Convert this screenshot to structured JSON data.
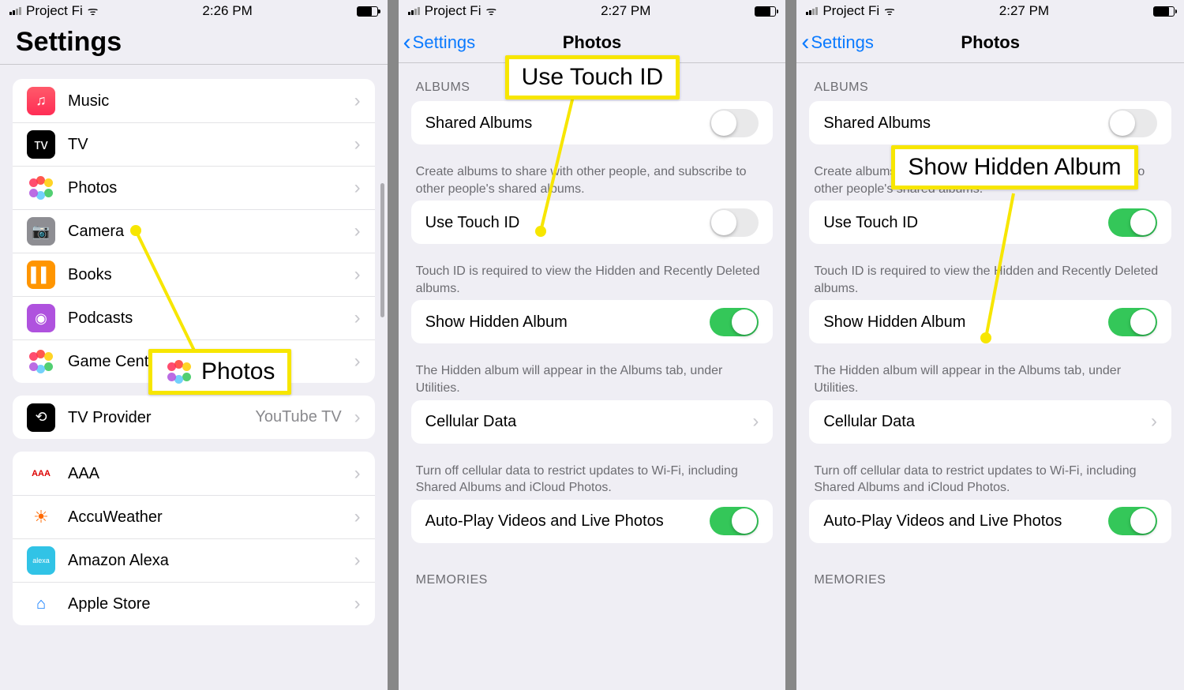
{
  "status": {
    "carrier": "Project Fi"
  },
  "screen1": {
    "time": "2:26 PM",
    "title": "Settings",
    "items_media": [
      {
        "label": "Music",
        "icon": "ic-music",
        "glyph": "♫"
      },
      {
        "label": "TV",
        "icon": "ic-tv",
        "glyph": "ᴛᴠ"
      },
      {
        "label": "Photos",
        "icon": "ic-photos",
        "glyph": ""
      },
      {
        "label": "Camera",
        "icon": "ic-camera",
        "glyph": "📷"
      },
      {
        "label": "Books",
        "icon": "ic-books",
        "glyph": "▌▌"
      },
      {
        "label": "Podcasts",
        "icon": "ic-podcasts",
        "glyph": "◉"
      },
      {
        "label": "Game Center",
        "icon": "ic-gamecenter",
        "glyph": "●●"
      }
    ],
    "items_tvprov": [
      {
        "label": "TV Provider",
        "icon": "ic-tvprov",
        "glyph": "⟲",
        "value": "YouTube TV"
      }
    ],
    "items_apps": [
      {
        "label": "AAA",
        "icon": "ic-aaa",
        "glyph": "AAA"
      },
      {
        "label": "AccuWeather",
        "icon": "ic-accu",
        "glyph": "☀"
      },
      {
        "label": "Amazon Alexa",
        "icon": "ic-alexa",
        "glyph": "alexa"
      },
      {
        "label": "Apple Store",
        "icon": "ic-appstore",
        "glyph": ""
      }
    ],
    "callout": {
      "text": "Photos"
    }
  },
  "photos_screen": {
    "time": "2:27 PM",
    "back": "Settings",
    "title": "Photos",
    "section_albums": "ALBUMS",
    "shared_albums": "Shared Albums",
    "shared_footer": "Create albums to share with other people, and subscribe to other people's shared albums.",
    "use_touch_id": "Use Touch ID",
    "touch_footer": "Touch ID is required to view the Hidden and Recently Deleted albums.",
    "show_hidden": "Show Hidden Album",
    "hidden_footer": "The Hidden album will appear in the Albums tab, under Utilities.",
    "cellular": "Cellular Data",
    "cellular_footer": "Turn off cellular data to restrict updates to Wi-Fi, including Shared Albums and iCloud Photos.",
    "autoplay": "Auto-Play Videos and Live Photos",
    "section_memories": "MEMORIES"
  },
  "screen2": {
    "touch_on": false,
    "hidden_on": true,
    "autoplay_on": true,
    "callout": {
      "text": "Use Touch ID"
    }
  },
  "screen3": {
    "touch_on": true,
    "hidden_on": true,
    "autoplay_on": true,
    "callout": {
      "text": "Show Hidden Album"
    }
  }
}
